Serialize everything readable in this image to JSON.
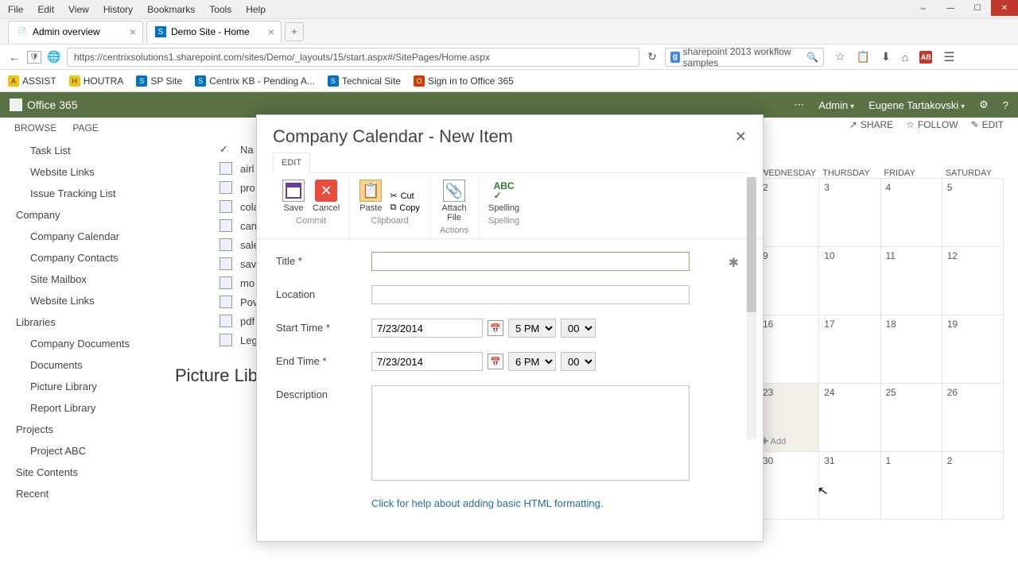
{
  "menu": {
    "items": [
      "File",
      "Edit",
      "View",
      "History",
      "Bookmarks",
      "Tools",
      "Help"
    ]
  },
  "tabs": [
    {
      "title": "Admin overview"
    },
    {
      "title": "Demo Site - Home"
    }
  ],
  "url": "https://centrixsolutions1.sharepoint.com/sites/Demo/_layouts/15/start.aspx#/SitePages/Home.aspx",
  "search": {
    "text": "sharepoint 2013 workflow samples"
  },
  "bookmarks": [
    "ASSIST",
    "HOUTRA",
    "SP Site",
    "Centrix KB - Pending A...",
    "Technical Site",
    "Sign in to Office 365"
  ],
  "suite": {
    "brand": "Office 365",
    "admin": "Admin",
    "user": "Eugene Tartakovski"
  },
  "ribbon_tabs": [
    "BROWSE",
    "PAGE"
  ],
  "page_commands": {
    "share": "SHARE",
    "follow": "FOLLOW",
    "edit": "EDIT"
  },
  "leftnav": {
    "items": [
      {
        "indent": 1,
        "label": "Task List"
      },
      {
        "indent": 1,
        "label": "Website Links"
      },
      {
        "indent": 1,
        "label": "Issue Tracking List"
      },
      {
        "indent": 0,
        "label": "Company"
      },
      {
        "indent": 1,
        "label": "Company Calendar"
      },
      {
        "indent": 1,
        "label": "Company Contacts"
      },
      {
        "indent": 1,
        "label": "Site Mailbox"
      },
      {
        "indent": 1,
        "label": "Website Links"
      },
      {
        "indent": 0,
        "label": "Libraries"
      },
      {
        "indent": 1,
        "label": "Company Documents"
      },
      {
        "indent": 1,
        "label": "Documents"
      },
      {
        "indent": 1,
        "label": "Picture Library"
      },
      {
        "indent": 1,
        "label": "Report Library"
      },
      {
        "indent": 0,
        "label": "Projects"
      },
      {
        "indent": 1,
        "label": "Project ABC"
      },
      {
        "indent": 0,
        "label": "Site Contents"
      },
      {
        "indent": 0,
        "label": "Recent"
      }
    ]
  },
  "doclist": {
    "header": "Na",
    "rows": [
      "airl",
      "pro",
      "cola",
      "can",
      "sale",
      "sav",
      "mo",
      "Pov",
      "pdf",
      "Leg"
    ]
  },
  "picture_heading": "Picture Lib",
  "calendar": {
    "days": [
      "WEDNESDAY",
      "THURSDAY",
      "FRIDAY",
      "SATURDAY"
    ],
    "weeks": [
      [
        "2",
        "3",
        "4",
        "5"
      ],
      [
        "9",
        "10",
        "11",
        "12"
      ],
      [
        "16",
        "17",
        "18",
        "19"
      ],
      [
        "23",
        "24",
        "25",
        "26"
      ],
      [
        "30",
        "31",
        "1",
        "2"
      ]
    ],
    "add_label": "Add"
  },
  "dialog": {
    "title": "Company Calendar - New Item",
    "tab": "EDIT",
    "ribbon": {
      "save": "Save",
      "cancel": "Cancel",
      "paste": "Paste",
      "cut": "Cut",
      "copy": "Copy",
      "attach": "Attach\nFile",
      "spelling": "Spelling",
      "groups": {
        "commit": "Commit",
        "clipboard": "Clipboard",
        "actions": "Actions",
        "spelling_g": "Spelling"
      }
    },
    "form": {
      "title_label": "Title *",
      "title_value": "",
      "location_label": "Location",
      "location_value": "",
      "start_label": "Start Time *",
      "start_date": "7/23/2014",
      "start_hour": "5 PM",
      "start_min": "00",
      "end_label": "End Time *",
      "end_date": "7/23/2014",
      "end_hour": "6 PM",
      "end_min": "00",
      "desc_label": "Description",
      "desc_value": "",
      "help": "Click for help about adding basic HTML formatting."
    }
  }
}
